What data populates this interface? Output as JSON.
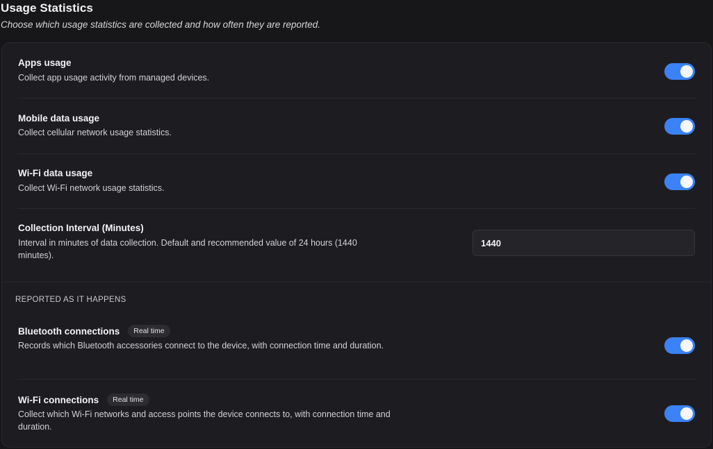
{
  "header": {
    "title": "Usage Statistics",
    "subtitle": "Choose which usage statistics are collected and how often they are reported."
  },
  "settings": [
    {
      "label": "Apps usage",
      "description": "Collect app usage activity from managed devices.",
      "enabled": true
    },
    {
      "label": "Mobile data usage",
      "description": "Collect cellular network usage statistics.",
      "enabled": true
    },
    {
      "label": "Wi-Fi data usage",
      "description": "Collect Wi-Fi network usage statistics.",
      "enabled": true
    }
  ],
  "interval": {
    "label": "Collection Interval (Minutes)",
    "description": "Interval in minutes of data collection. Default and recommended value of 24 hours (1440 minutes).",
    "value": "1440"
  },
  "realtime_section": {
    "header": "REPORTED AS IT HAPPENS",
    "items": [
      {
        "label": "Bluetooth connections",
        "badge": "Real time",
        "description": "Records which Bluetooth accessories connect to the device, with connection time and duration.",
        "enabled": true
      },
      {
        "label": "Wi-Fi connections",
        "badge": "Real time",
        "description": "Collect which Wi-Fi networks and access points the device connects to, with connection time and duration.",
        "enabled": true
      }
    ]
  },
  "colors": {
    "toggle_on": "#3b82f6",
    "background": "#17171a",
    "card": "#1d1d21"
  }
}
